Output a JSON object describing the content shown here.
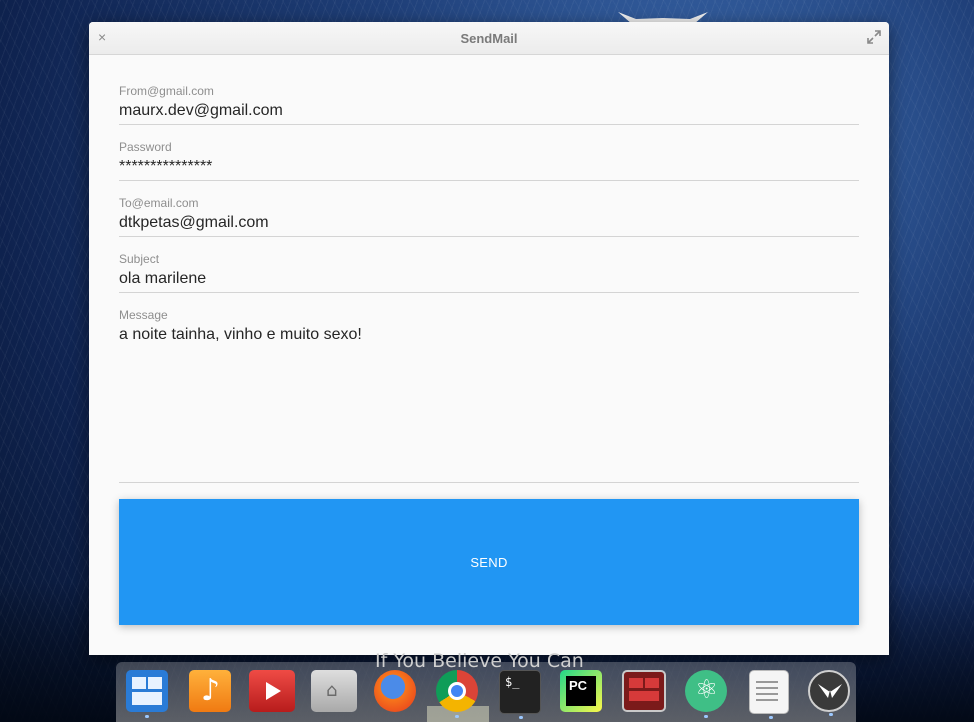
{
  "window": {
    "title": "SendMail"
  },
  "form": {
    "from_label": "From@gmail.com",
    "from_value": "maurx.dev@gmail.com",
    "password_label": "Password",
    "password_value": "***************",
    "to_label": "To@email.com",
    "to_value": "dtkpetas@gmail.com",
    "subject_label": "Subject",
    "subject_value": "ola marilene",
    "message_label": "Message",
    "message_value": "a noite tainha, vinho e muito sexo!",
    "send_label": "SEND"
  },
  "wallpaper": {
    "motto": "If You Believe You Can"
  },
  "dock": {
    "items": [
      "multitasking-view-icon",
      "music-icon",
      "videos-icon",
      "files-icon",
      "firefox-icon",
      "chrome-icon",
      "terminal-icon",
      "pycharm-icon",
      "remote-terminal-icon",
      "atom-icon",
      "text-editor-icon",
      "kivy-icon"
    ]
  },
  "colors": {
    "accent": "#2196f3"
  }
}
